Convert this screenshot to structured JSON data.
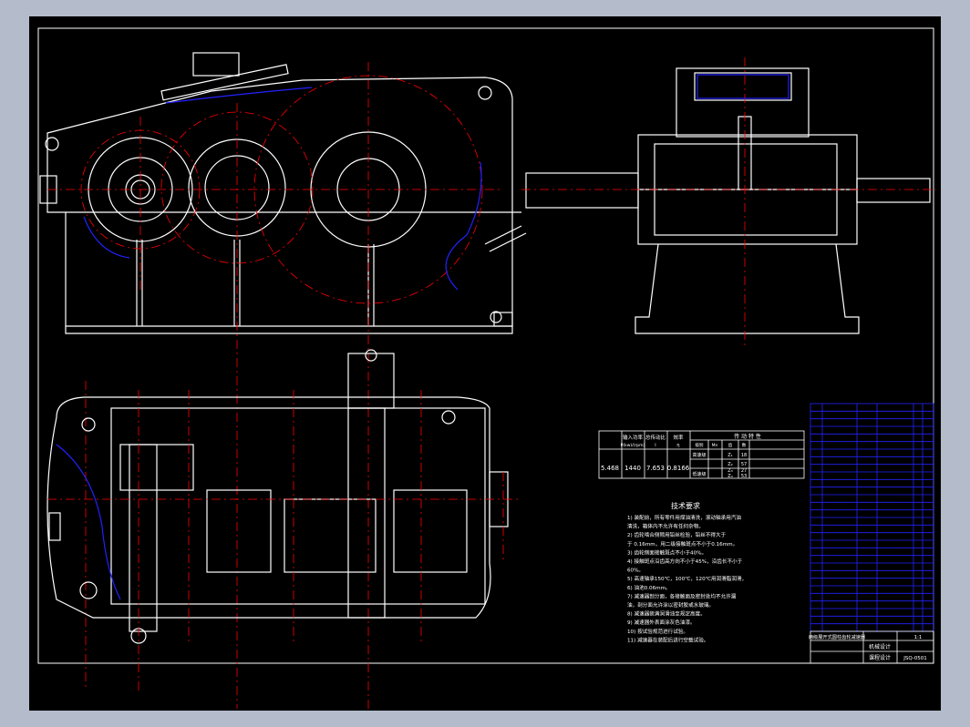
{
  "performance_table": {
    "title": "传 动 特 性",
    "col_power": "输入功率",
    "col_power_unit": "P(kw)/(rpm)",
    "col_ratio": "总传动比",
    "col_ratio_sub": "i",
    "col_eff": "效率",
    "col_eff_sub": "η",
    "values": [
      "5.468",
      "1440",
      "7.653",
      "0.8166"
    ],
    "stage_head": [
      "级别",
      "Mn",
      "齿",
      "数"
    ],
    "stage1_label": "高速级",
    "stage2_label": "低速级",
    "rows": [
      {
        "z": "Z₁",
        "n": "18"
      },
      {
        "z": "Z₂",
        "n": "57"
      },
      {
        "z": "Z₃",
        "n": "27"
      },
      {
        "z": "Z₄",
        "n": "53"
      }
    ]
  },
  "tech_requirements": {
    "title": "技术要求",
    "lines": [
      "1) 装配前，所有零件用煤油清洗，滚动轴承用汽油",
      "清洗，箱体内不允许有任何杂物。",
      "2) 齿轮啮合侧隙用铅丝检验，铅丝不得大于",
      "于 0.16mm，用二级接触斑点不小于0.16mm。",
      "3) 齿轮侧面接触斑点不小于40%。",
      "4) 接触斑点沿齿高方向不小于45%，沿齿长不小于",
      "60%。",
      "5) 高速轴承150℃，100℃，120℃用润滑脂润滑，",
      "6) 油池0.06mm。",
      "7) 减速器剖分面，各接触面及密封处均不允许漏",
      "油，剖分面允许涂以密封胶或水玻璃。",
      "8) 减速器装满润滑油至规定高度。",
      "9) 减速器外表面涂灰色油漆。",
      "10) 按试验规范进行试验。",
      "11) 减速器在装配后进行空载试验。"
    ]
  },
  "title_block": {
    "drawing_name": "两级展开式圆柱齿轮减速器",
    "scale": "1:1",
    "design": "机械设计",
    "course": "课程设计",
    "code": "JSQ-0501"
  }
}
